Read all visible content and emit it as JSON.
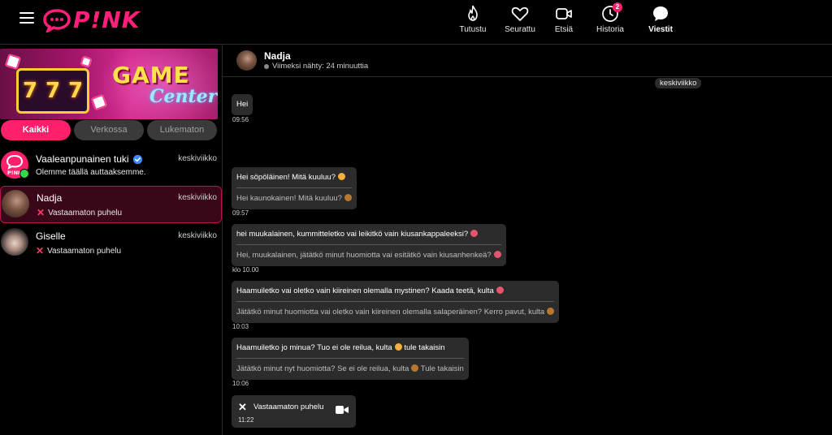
{
  "brand": {
    "name": "P!NK",
    "accent": "#ff1f6b"
  },
  "nav": [
    {
      "label": "Tutustu",
      "icon": "flame-icon"
    },
    {
      "label": "Seurattu",
      "icon": "heart-icon"
    },
    {
      "label": "Etsiä",
      "icon": "video-icon"
    },
    {
      "label": "Historia",
      "icon": "history-clock-icon",
      "badge": "2"
    },
    {
      "label": "Viestit",
      "icon": "chat-bubble-icon",
      "active": true
    }
  ],
  "banner": {
    "title": "GAME",
    "subtitle": "Center",
    "slot": [
      "7",
      "7",
      "7"
    ]
  },
  "filters": [
    "Kaikki",
    "Verkossa",
    "Lukematon"
  ],
  "conversations": [
    {
      "name": "Vaaleanpunainen tuki",
      "verified": true,
      "preview": "Olemme täällä auttaaksemme.",
      "date": "keskiviikko",
      "avatar_label": "P!NK"
    },
    {
      "name": "Nadja",
      "preview": "Vastaamaton puhelu",
      "date": "keskiviikko",
      "active": true
    },
    {
      "name": "Giselle",
      "preview": "Vastaamaton puhelu",
      "date": "keskiviikko"
    }
  ],
  "chat": {
    "contact_name": "Nadja",
    "status": "Viimeksi nähty: 24 minuuttia",
    "day_label": "keskiviikko",
    "messages": [
      {
        "text": "Hei",
        "time": "09:56"
      },
      {
        "text": "Hei söpöläinen! Mitä kuuluu?",
        "translation": "Hei kaunokainen! Mitä kuuluu?",
        "time": "09:57"
      },
      {
        "text": "hei muukalainen, kummitteletko vai leikitkö vain kiusankappaleeksi?",
        "translation": "Hei, muukalainen, jätätkö minut huomiotta vai esitätkö vain kiusanhenkeä?",
        "time": "klo 10.00"
      },
      {
        "text": "Haamuiletko vai oletko vain kiireinen olemalla mystinen? Kaada teetä, kulta",
        "translation": "Jätätkö minut huomiotta vai oletko vain kiireinen olemalla salaperäinen? Kerro pavut, kulta",
        "time": "10:03"
      },
      {
        "text": "Haamuiletko jo minua? Tuo ei ole reilua, kulta",
        "text_after": "tule takaisin",
        "translation": "Jätätkö minut nyt huomiotta? Se ei ole reilua, kulta",
        "translation_after": "Tule takaisin",
        "time": "10:06"
      }
    ],
    "missed_call": {
      "label": "Vastaamaton puhelu",
      "time": "11:22"
    }
  }
}
